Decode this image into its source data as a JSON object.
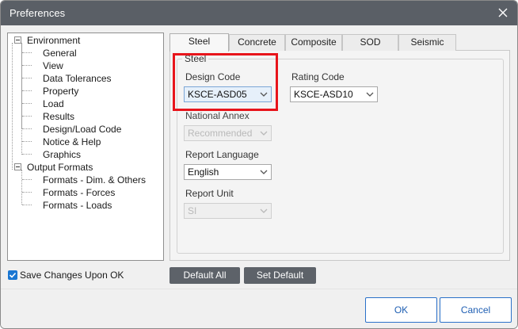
{
  "window": {
    "title": "Preferences",
    "close_icon": "close-icon"
  },
  "tree": {
    "environment": {
      "label": "Environment",
      "children": [
        "General",
        "View",
        "Data Tolerances",
        "Property",
        "Load",
        "Results",
        "Design/Load Code",
        "Notice & Help",
        "Graphics"
      ]
    },
    "output_formats": {
      "label": "Output Formats",
      "children": [
        "Formats - Dim. & Others",
        "Formats - Forces",
        "Formats - Loads"
      ]
    }
  },
  "save_changes": {
    "label": "Save Changes Upon OK",
    "checked": true
  },
  "tabs": [
    "Steel",
    "Concrete",
    "Composite",
    "SOD",
    "Seismic"
  ],
  "active_tab": "Steel",
  "steel": {
    "group_label": "Steel",
    "design_code": {
      "label": "Design Code",
      "value": "KSCE-ASD05"
    },
    "rating_code": {
      "label": "Rating Code",
      "value": "KSCE-ASD10"
    },
    "national_annex": {
      "label": "National Annex",
      "value": "Recommended",
      "disabled": true
    },
    "report_language": {
      "label": "Report Language",
      "value": "English"
    },
    "report_unit": {
      "label": "Report Unit",
      "value": "SI",
      "disabled": true
    }
  },
  "buttons": {
    "default_all": "Default All",
    "set_default": "Set Default",
    "ok": "OK",
    "cancel": "Cancel"
  },
  "colors": {
    "titlebar": "#5a5f66",
    "highlight": "#e8141b",
    "accent": "#1976d2"
  }
}
